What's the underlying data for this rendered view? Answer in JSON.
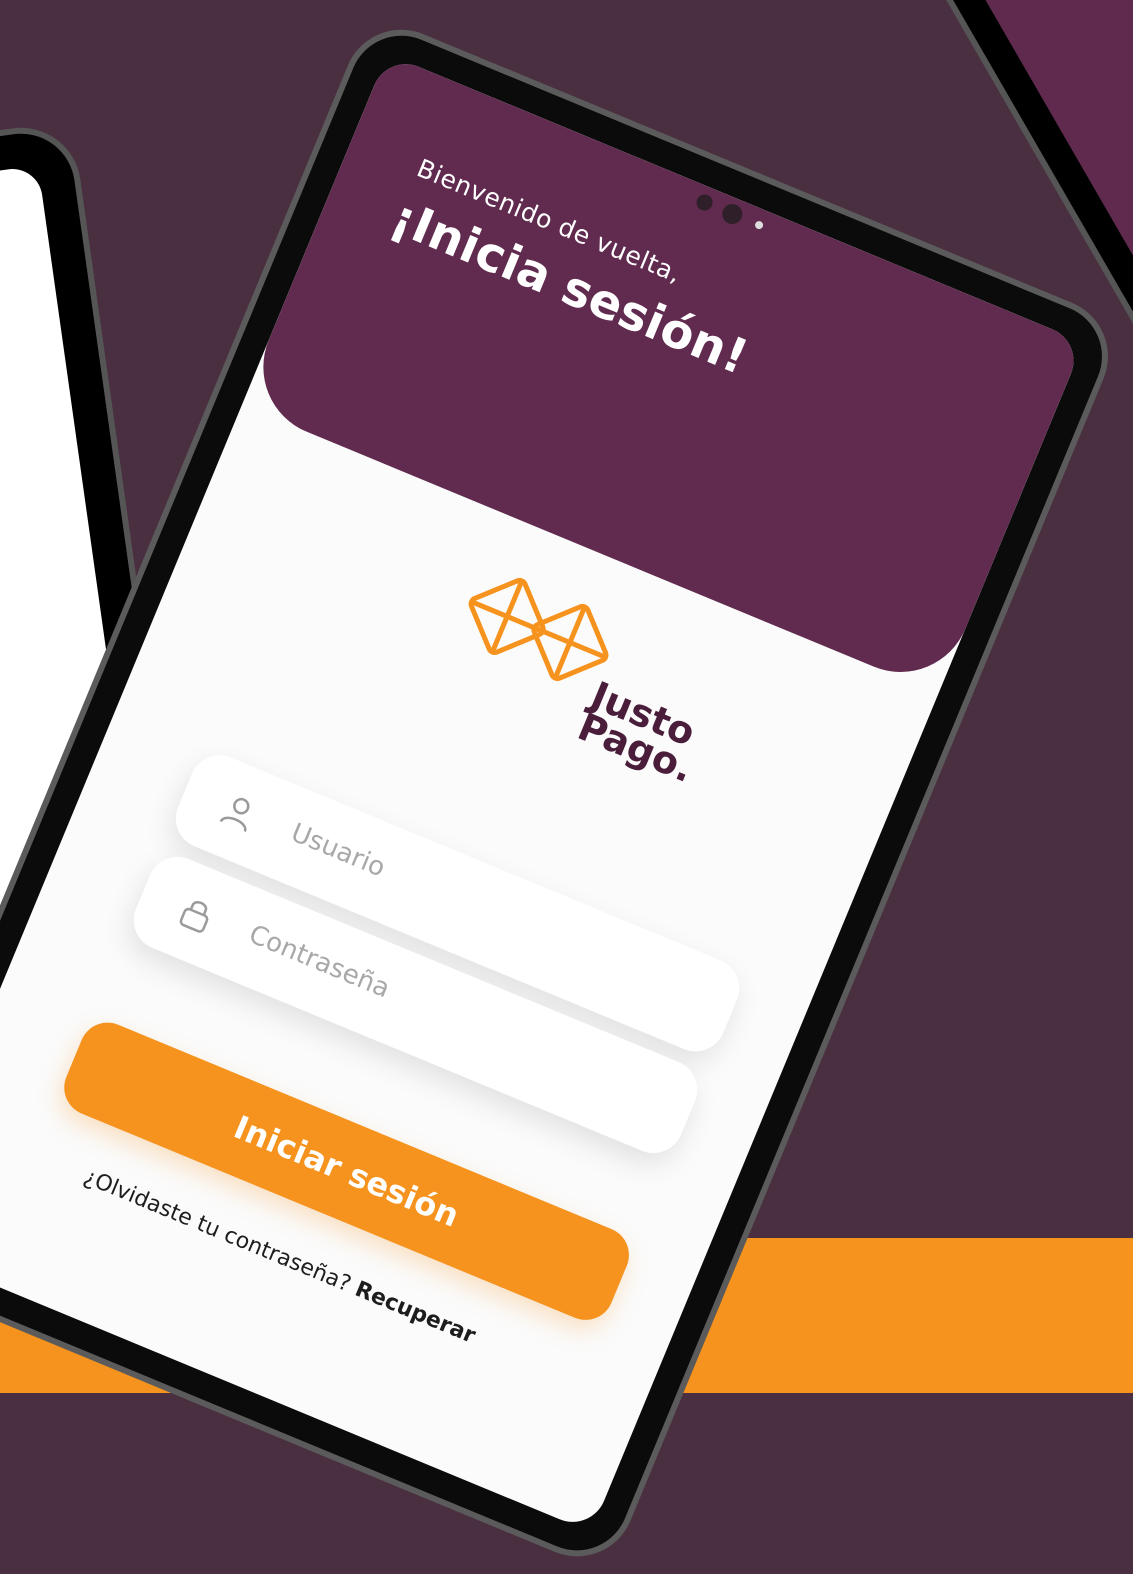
{
  "colors": {
    "brand_purple": "#612a4f",
    "brand_orange": "#f6931e",
    "background": "#4a2f41"
  },
  "header": {
    "welcome": "Bienvenido de vuelta,",
    "title": "¡Inicia sesión!"
  },
  "logo": {
    "line1": "Justo",
    "line2": "Pago."
  },
  "form": {
    "username": {
      "icon": "user-icon",
      "placeholder": "Usuario"
    },
    "password": {
      "icon": "lock-icon",
      "placeholder": "Contraseña"
    }
  },
  "login_button": "Iniciar sesión",
  "forgot": {
    "question": "¿Olvidaste tu contraseña?",
    "link": "Recuperar"
  }
}
